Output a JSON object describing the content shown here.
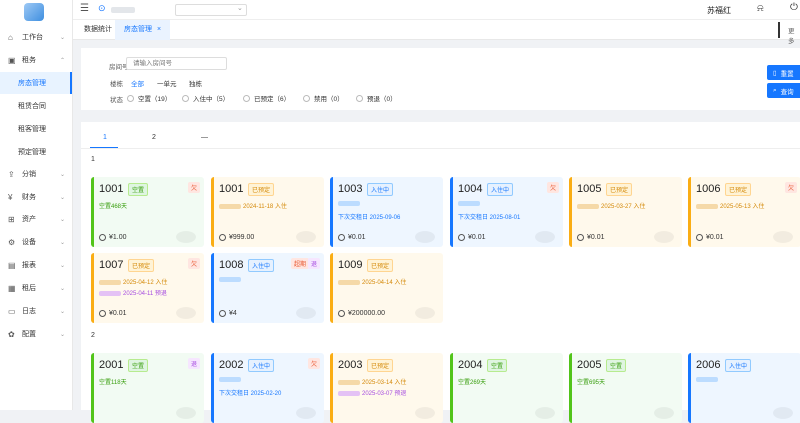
{
  "user": {
    "name": "苏福红"
  },
  "tabs": [
    {
      "label": "数据统计"
    },
    {
      "label": "房态管理",
      "close": "×"
    }
  ],
  "topbar": {
    "more": "更多"
  },
  "sidebar": {
    "menus": [
      {
        "label": "工作台"
      },
      {
        "label": "租务"
      },
      {
        "label": "分销"
      },
      {
        "label": "财务"
      },
      {
        "label": "资产"
      },
      {
        "label": "设备"
      },
      {
        "label": "报表"
      },
      {
        "label": "租后"
      },
      {
        "label": "日志"
      },
      {
        "label": "配置"
      }
    ],
    "sub": [
      "房态管理",
      "租赁合同",
      "租客管理",
      "预定管理"
    ]
  },
  "filter": {
    "room_label": "房间号",
    "room_placeholder": "请输入房间号",
    "building_label": "楼栋",
    "buildings": [
      "全部",
      "一单元",
      "独栋"
    ],
    "status_label": "状态",
    "statuses": [
      "空置（19）",
      "入住中（5）",
      "已预定（6）",
      "禁用（0）",
      "预退（0）"
    ],
    "reset": "重置",
    "search": "查询"
  },
  "pages": [
    "1",
    "2",
    "—"
  ],
  "floors": [
    {
      "label": "1",
      "cards": [
        {
          "num": "1001",
          "status": "空置",
          "badges": [
            "欠"
          ],
          "l1": "空置468天",
          "l2": "",
          "price": "¥1.00"
        },
        {
          "num": "1001",
          "status": "已预定",
          "badges": [],
          "l1": "2024-11-18 入住",
          "l2": "",
          "price": "¥999.00"
        },
        {
          "num": "1003",
          "status": "入住中",
          "badges": [],
          "l1": "",
          "l2": "下次交租日 2025-09-06",
          "price": "¥0.01"
        },
        {
          "num": "1004",
          "status": "入住中",
          "badges": [
            "欠"
          ],
          "l1": "",
          "l2": "下次交租日 2025-08-01",
          "price": "¥0.01"
        },
        {
          "num": "1005",
          "status": "已预定",
          "badges": [],
          "l1": "2025-03-27 入住",
          "l2": "",
          "price": "¥0.01"
        },
        {
          "num": "1006",
          "status": "已预定",
          "badges": [
            "欠"
          ],
          "l1": "2025-05-13 入住",
          "l2": "",
          "price": "¥0.01"
        },
        {
          "num": "1007",
          "status": "已预定",
          "badges": [
            "欠"
          ],
          "l1": "2025-04-12 入住",
          "l2": "2025-04-11 预退",
          "price": "¥0.01"
        },
        {
          "num": "1008",
          "status": "入住中",
          "badges": [
            "超期",
            "退"
          ],
          "l1": "",
          "l2": "",
          "price": "¥4"
        },
        {
          "num": "1009",
          "status": "已预定",
          "badges": [],
          "l1": "2025-04-14 入住",
          "l2": "",
          "price": "¥200000.00"
        }
      ]
    },
    {
      "label": "2",
      "cards": [
        {
          "num": "2001",
          "status": "空置",
          "badges": [
            "退"
          ],
          "l1": "空置118天",
          "l2": "",
          "price": ""
        },
        {
          "num": "2002",
          "status": "入住中",
          "badges": [
            "欠"
          ],
          "l1": "",
          "l2": "下次交租日 2025-02-20",
          "price": ""
        },
        {
          "num": "2003",
          "status": "已预定",
          "badges": [],
          "l1": "2025-03-14 入住",
          "l2": "2025-03-07 预退",
          "price": ""
        },
        {
          "num": "2004",
          "status": "空置",
          "badges": [],
          "l1": "空置269天",
          "l2": "",
          "price": ""
        },
        {
          "num": "2005",
          "status": "空置",
          "badges": [],
          "l1": "空置695天",
          "l2": "",
          "price": ""
        },
        {
          "num": "2006",
          "status": "入住中",
          "badges": [],
          "l1": "",
          "l2": "",
          "price": ""
        }
      ]
    }
  ]
}
